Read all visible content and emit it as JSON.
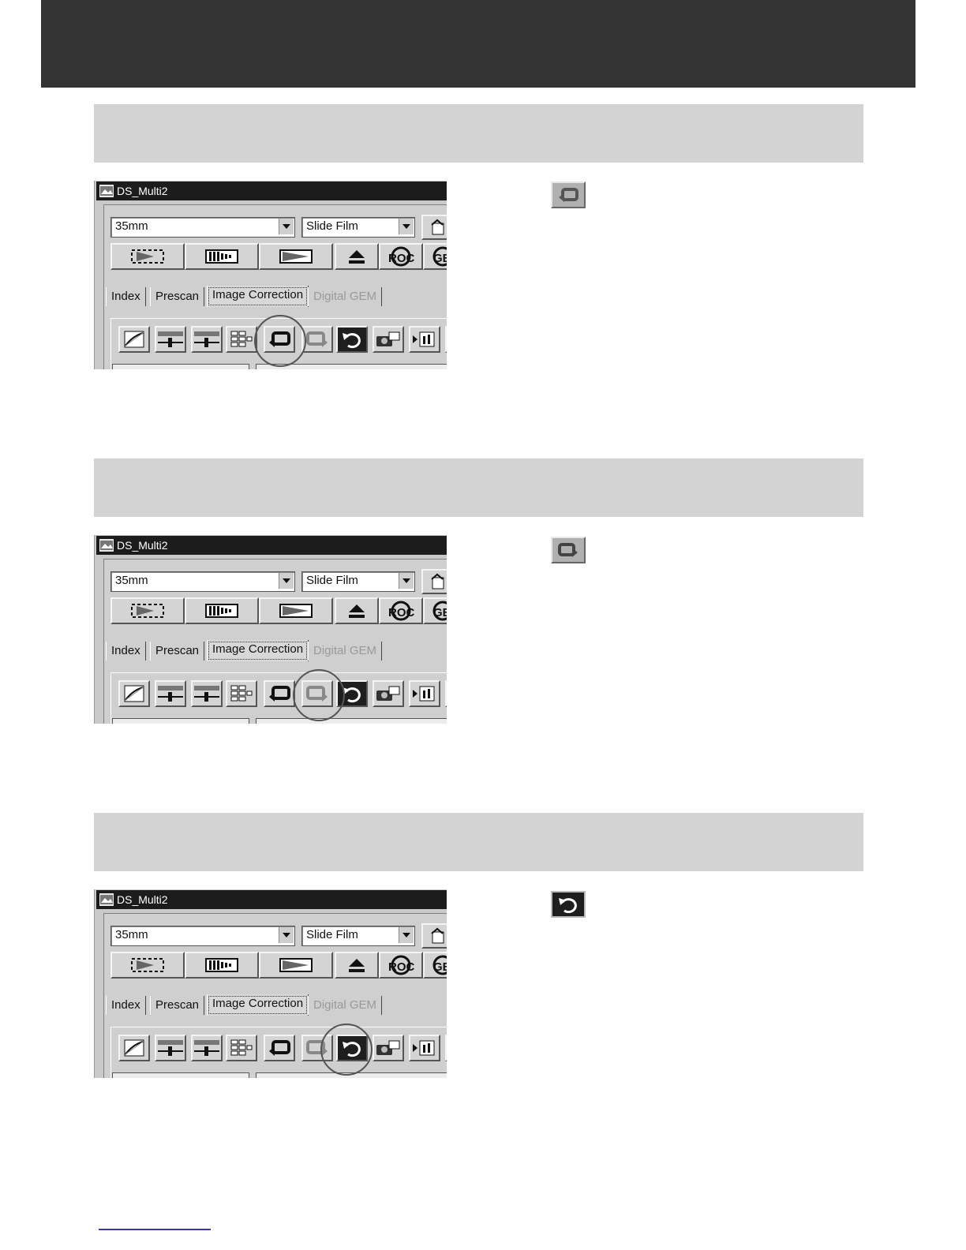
{
  "sections": [
    {
      "window_title": "DS_Multi2",
      "film_format": "35mm",
      "film_type": "Slide Film",
      "tabs": [
        "Index",
        "Prescan",
        "Image Correction",
        "Digital GEM"
      ],
      "toolbar_labels": [
        "ROC",
        "GE"
      ],
      "highlighted_button": "undo-button",
      "side_icon": "undo-icon"
    },
    {
      "window_title": "DS_Multi2",
      "film_format": "35mm",
      "film_type": "Slide Film",
      "tabs": [
        "Index",
        "Prescan",
        "Image Correction",
        "Digital GEM"
      ],
      "toolbar_labels": [
        "ROC",
        "GE"
      ],
      "highlighted_button": "redo-button",
      "side_icon": "redo-icon"
    },
    {
      "window_title": "DS_Multi2",
      "film_format": "35mm",
      "film_type": "Slide Film",
      "tabs": [
        "Index",
        "Prescan",
        "Image Correction",
        "Digital GEM"
      ],
      "toolbar_labels": [
        "ROC",
        "GE"
      ],
      "highlighted_button": "reset-button",
      "side_icon": "reset-icon"
    }
  ],
  "colors": {
    "header_band": "#333333",
    "section_bar": "#d3d3d3",
    "titlebar": "#1c1c1c",
    "footer_rule": "#3838a8"
  }
}
